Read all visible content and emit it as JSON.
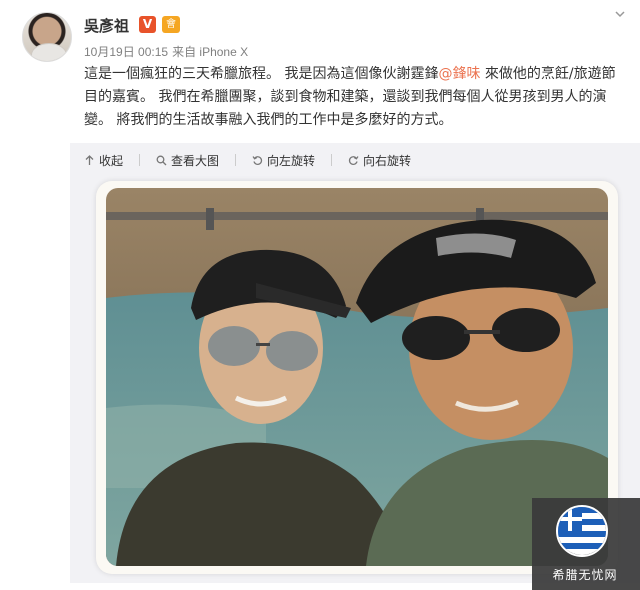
{
  "post": {
    "username": "吳彥祖",
    "verified_badge": "V",
    "member_badge": "會",
    "date": "10月19日 00:15",
    "source": "来自 iPhone X",
    "text_part1": "這是一個瘋狂的三天希臘旅程。 我是因為這個像伙謝霆鋒",
    "mention": "@鋒味",
    "text_part2": " 來做他的烹飪/旅遊節目的嘉賓。 我們在希臘團聚，談到食物和建築，還談到我們每個人從男孩到男人的演變。 將我們的生活故事融入我們的工作中是多麼好的方式。"
  },
  "toolbar": {
    "collapse": "收起",
    "view_large": "查看大图",
    "rotate_left": "向左旋转",
    "rotate_right": "向右旋转"
  },
  "watermark": {
    "text": "希腊无忧网"
  },
  "colors": {
    "mention": "#eb7350",
    "verified": "#e8532a",
    "panel": "#f2f2f5",
    "greek_blue": "#1d5fb8"
  },
  "icons": [
    "avatar",
    "verified-icon",
    "member-icon",
    "chevron-down-icon",
    "collapse-icon",
    "search-icon",
    "rotate-left-icon",
    "rotate-right-icon",
    "greek-flag-icon"
  ]
}
